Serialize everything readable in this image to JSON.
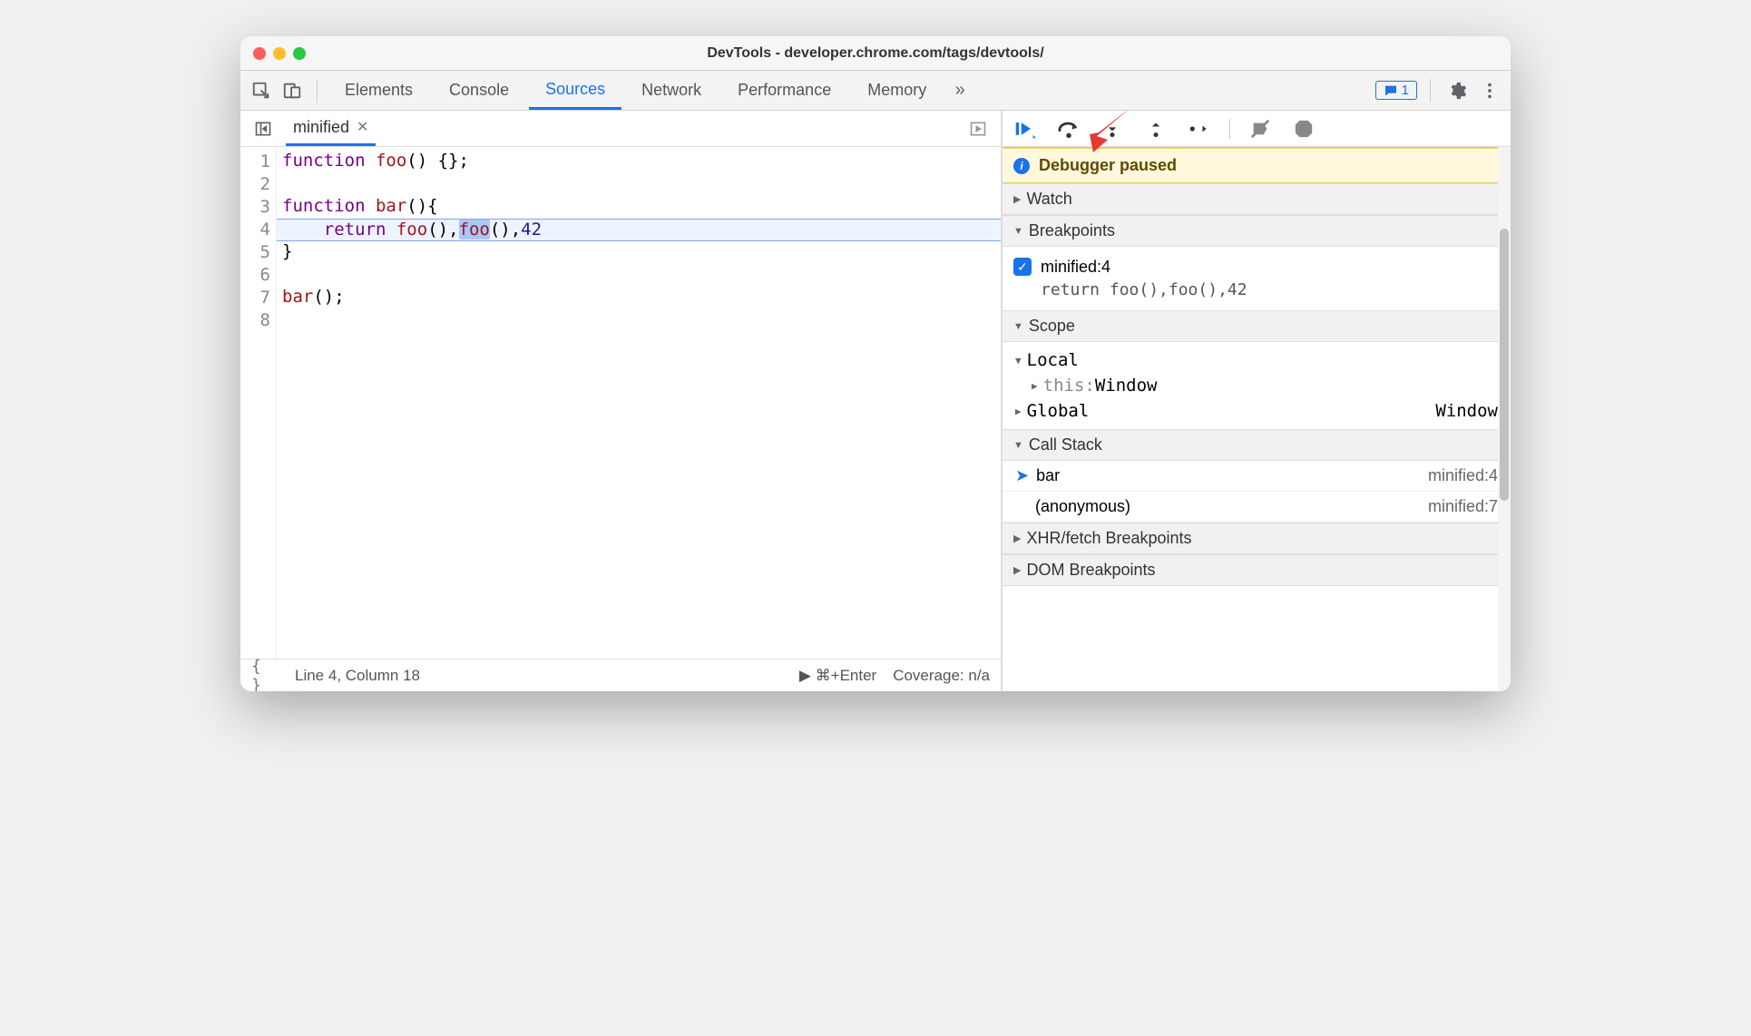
{
  "window": {
    "title": "DevTools - developer.chrome.com/tags/devtools/"
  },
  "tabs": {
    "elements": "Elements",
    "console": "Console",
    "sources": "Sources",
    "network": "Network",
    "performance": "Performance",
    "memory": "Memory"
  },
  "toolbar_badge_count": "1",
  "file_tab": {
    "name": "minified"
  },
  "code": {
    "lines": [
      {
        "num": "1",
        "raw": "function foo() {};"
      },
      {
        "num": "2",
        "raw": ""
      },
      {
        "num": "3",
        "raw": "function bar(){"
      },
      {
        "num": "4",
        "raw": "    return foo(),foo(),42"
      },
      {
        "num": "5",
        "raw": "}"
      },
      {
        "num": "6",
        "raw": ""
      },
      {
        "num": "7",
        "raw": "bar();"
      },
      {
        "num": "8",
        "raw": ""
      }
    ],
    "highlight_line": 4,
    "highlight_token": "foo"
  },
  "statusbar": {
    "position": "Line 4, Column 18",
    "run": "⌘+Enter",
    "coverage": "Coverage: n/a"
  },
  "debugger": {
    "paused_label": "Debugger paused",
    "sections": {
      "watch": "Watch",
      "breakpoints": "Breakpoints",
      "scope": "Scope",
      "callstack": "Call Stack",
      "xhr": "XHR/fetch Breakpoints",
      "dom": "DOM Breakpoints"
    },
    "breakpoint": {
      "label": "minified:4",
      "code": "return foo(),foo(),42"
    },
    "scope": {
      "local_label": "Local",
      "this_label": "this",
      "this_value": "Window",
      "global_label": "Global",
      "global_value": "Window"
    },
    "callstack": [
      {
        "name": "bar",
        "loc": "minified:4",
        "current": true
      },
      {
        "name": "(anonymous)",
        "loc": "minified:7",
        "current": false
      }
    ]
  }
}
